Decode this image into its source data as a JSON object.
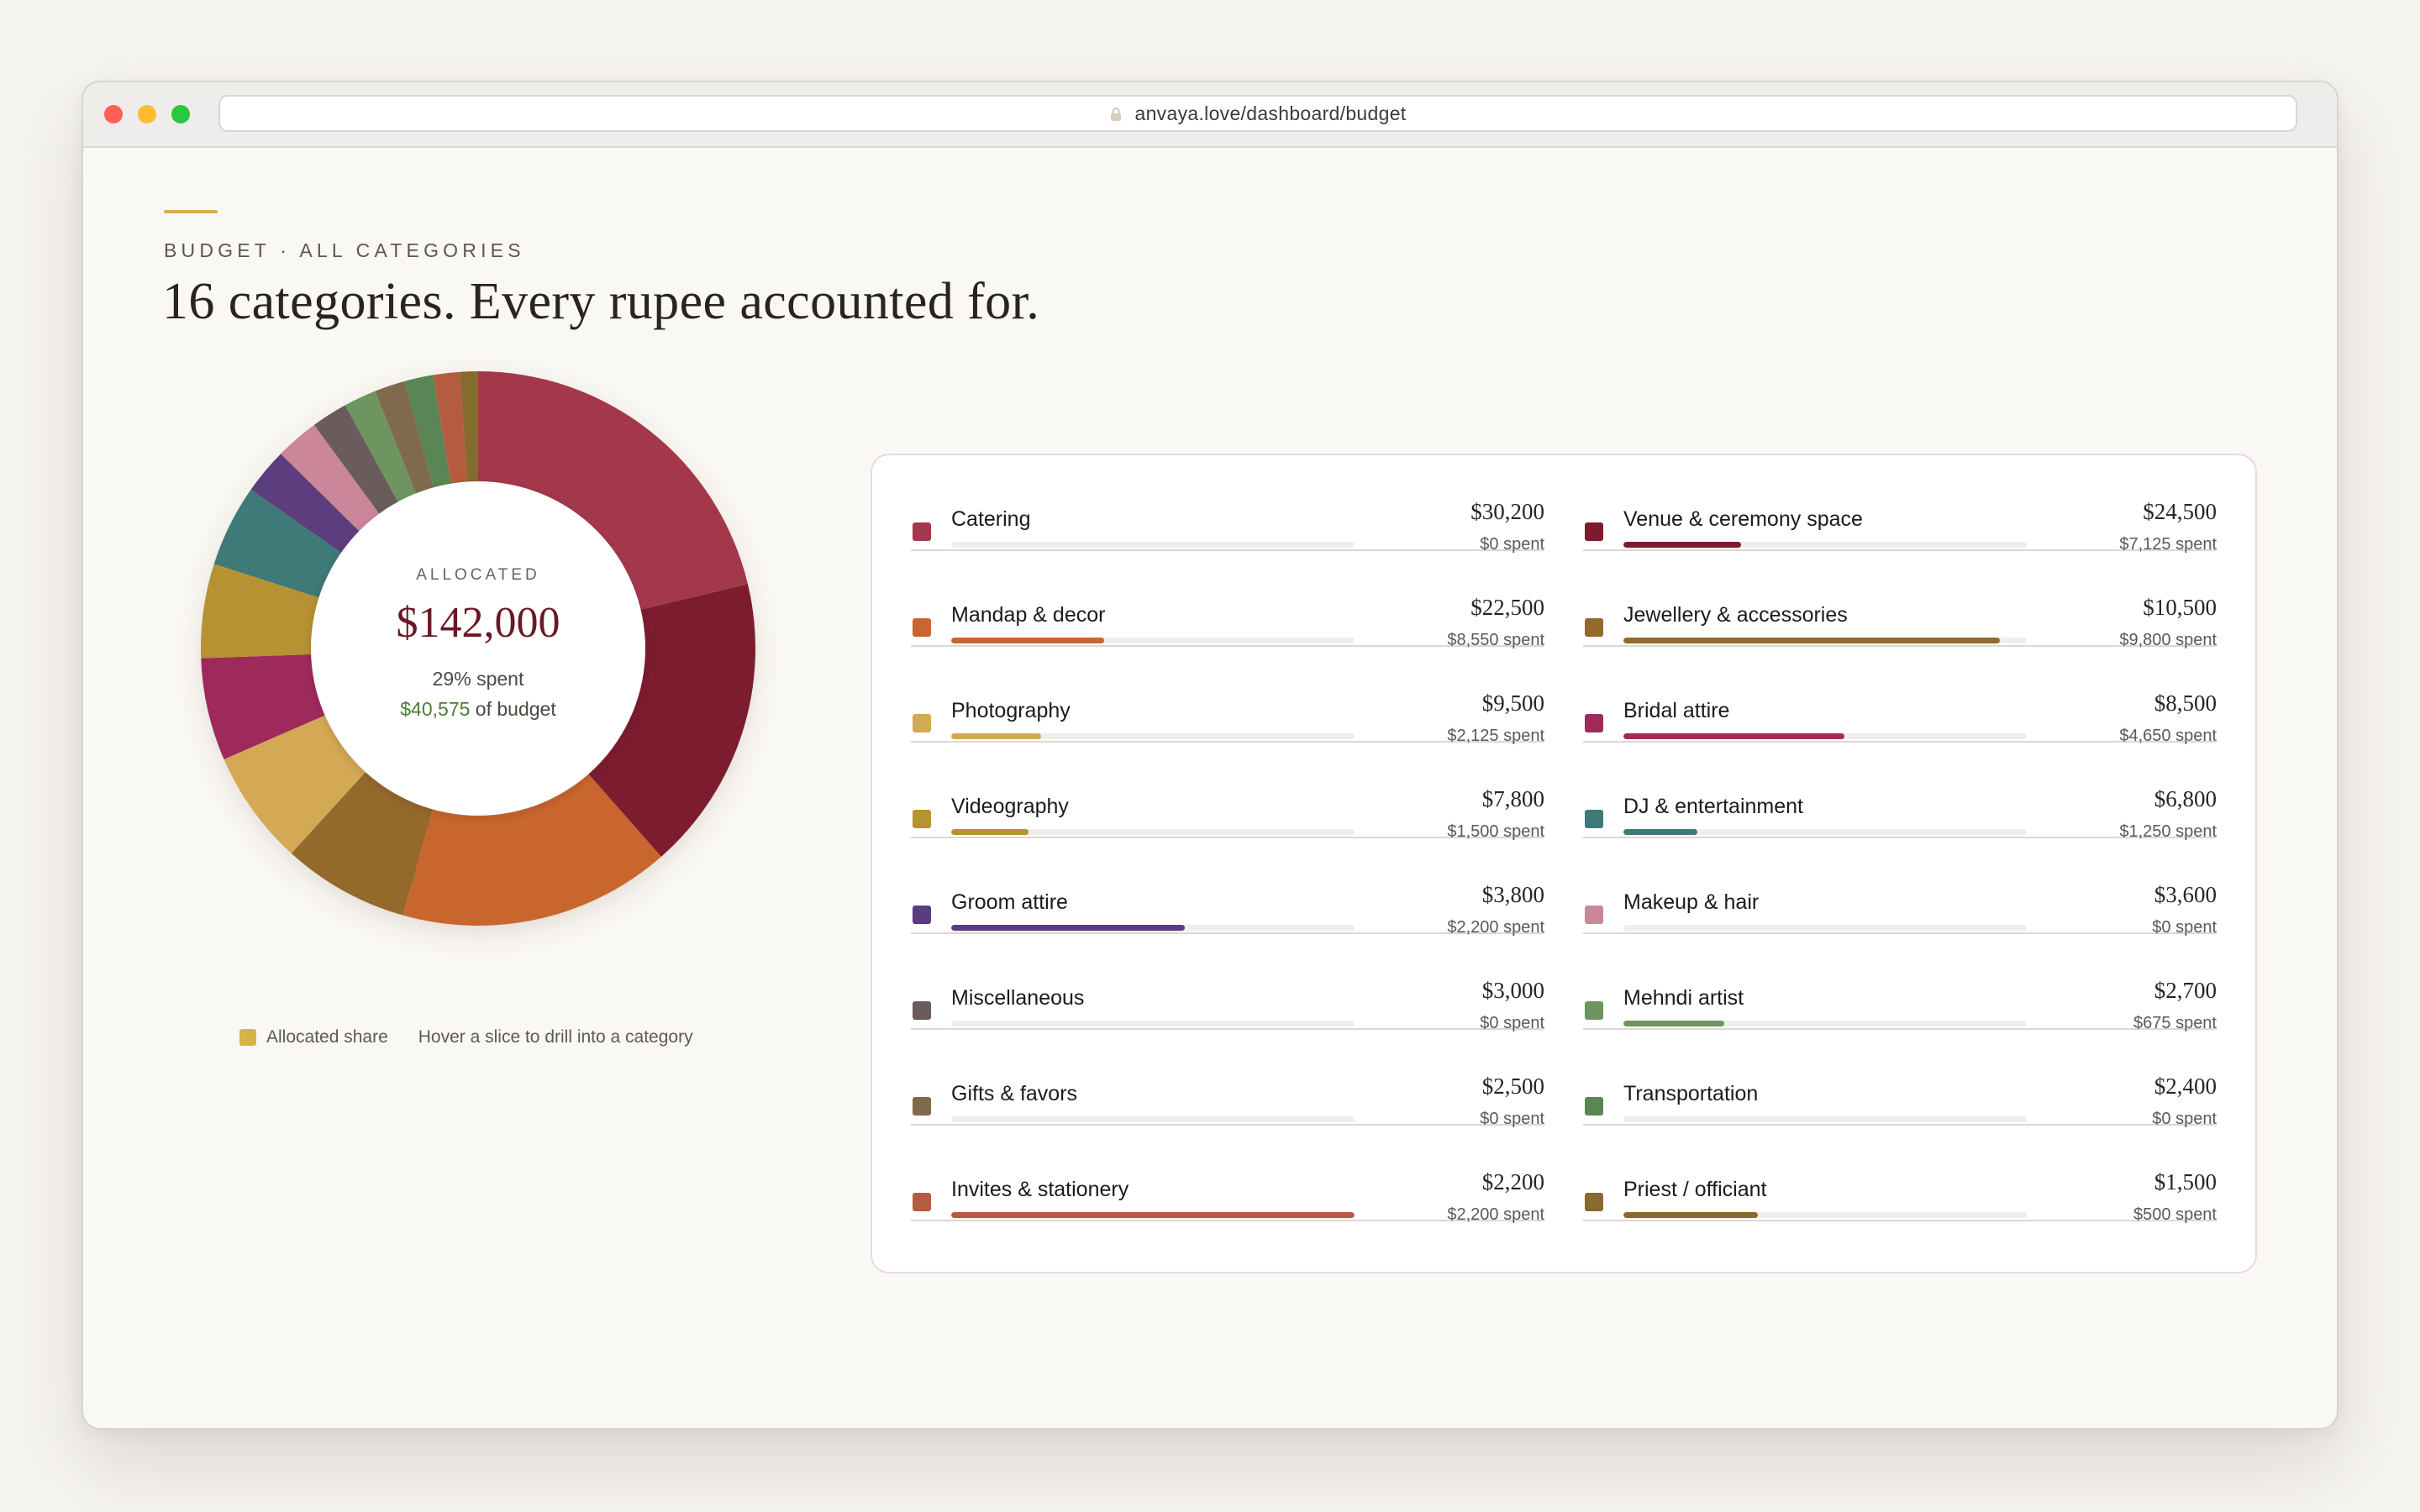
{
  "browser": {
    "url": "anvaya.love/dashboard/budget",
    "lock_icon": "lock-icon"
  },
  "page": {
    "eyebrow": "BUDGET · ALL CATEGORIES",
    "headline": "16 categories. Every rupee accounted for."
  },
  "donut": {
    "center_label": "ALLOCATED",
    "center_amount": "$142,000",
    "spent_pct": "29% spent",
    "budget_amount": "$40,575",
    "budget_suffix": " of budget",
    "legend_label": "Allocated share",
    "legend_hint": "Hover a slice to drill into a category"
  },
  "categories": [
    {
      "name": "Catering",
      "amount": "$30,200",
      "spent": "$0 spent",
      "value": 30200,
      "spent_value": 0,
      "color": "#a3384c"
    },
    {
      "name": "Venue & ceremony space",
      "amount": "$24,500",
      "spent": "$7,125 spent",
      "value": 24500,
      "spent_value": 7125,
      "color": "#7b1c2e"
    },
    {
      "name": "Mandap & decor",
      "amount": "$22,500",
      "spent": "$8,550 spent",
      "value": 22500,
      "spent_value": 8550,
      "color": "#c9662f"
    },
    {
      "name": "Jewellery & accessories",
      "amount": "$10,500",
      "spent": "$9,800 spent",
      "value": 10500,
      "spent_value": 9800,
      "color": "#936a2b"
    },
    {
      "name": "Photography",
      "amount": "$9,500",
      "spent": "$2,125 spent",
      "value": 9500,
      "spent_value": 2125,
      "color": "#d4a954"
    },
    {
      "name": "Bridal attire",
      "amount": "$8,500",
      "spent": "$4,650 spent",
      "value": 8500,
      "spent_value": 4650,
      "color": "#9e2c5b"
    },
    {
      "name": "Videography",
      "amount": "$7,800",
      "spent": "$1,500 spent",
      "value": 7800,
      "spent_value": 1500,
      "color": "#b69231"
    },
    {
      "name": "DJ & entertainment",
      "amount": "$6,800",
      "spent": "$1,250 spent",
      "value": 6800,
      "spent_value": 1250,
      "color": "#3e7a78"
    },
    {
      "name": "Groom attire",
      "amount": "$3,800",
      "spent": "$2,200 spent",
      "value": 3800,
      "spent_value": 2200,
      "color": "#5b3c7e"
    },
    {
      "name": "Makeup & hair",
      "amount": "$3,600",
      "spent": "$0 spent",
      "value": 3600,
      "spent_value": 0,
      "color": "#cb8699"
    },
    {
      "name": "Miscellaneous",
      "amount": "$3,000",
      "spent": "$0 spent",
      "value": 3000,
      "spent_value": 0,
      "color": "#6b5b5b"
    },
    {
      "name": "Mehndi artist",
      "amount": "$2,700",
      "spent": "$675 spent",
      "value": 2700,
      "spent_value": 675,
      "color": "#6e9460"
    },
    {
      "name": "Gifts & favors",
      "amount": "$2,500",
      "spent": "$0 spent",
      "value": 2500,
      "spent_value": 0,
      "color": "#7f6a4d"
    },
    {
      "name": "Transportation",
      "amount": "$2,400",
      "spent": "$0 spent",
      "value": 2400,
      "spent_value": 0,
      "color": "#5a8654"
    },
    {
      "name": "Invites & stationery",
      "amount": "$2,200",
      "spent": "$2,200 spent",
      "value": 2200,
      "spent_value": 2200,
      "color": "#b55b40"
    },
    {
      "name": "Priest / officiant",
      "amount": "$1,500",
      "spent": "$500 spent",
      "value": 1500,
      "spent_value": 500,
      "color": "#876a2e"
    }
  ],
  "colors": {
    "accent_gold": "#d4b04a",
    "amount_maroon": "#6a1827",
    "spent_green": "#4c7d3a",
    "card_border": "#ead9de"
  }
}
